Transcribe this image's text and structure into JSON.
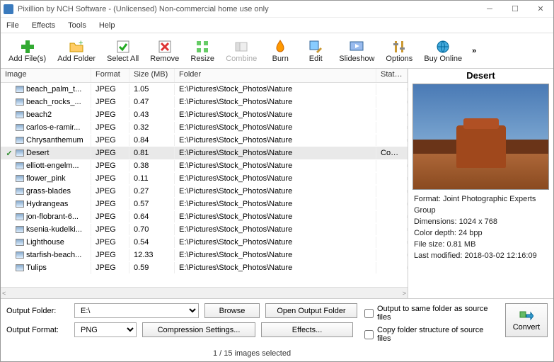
{
  "window": {
    "title": "Pixillion by NCH Software - (Unlicensed) Non-commercial home use only"
  },
  "menu": [
    "File",
    "Effects",
    "Tools",
    "Help"
  ],
  "toolbar": [
    {
      "id": "add-files",
      "label": "Add File(s)"
    },
    {
      "id": "add-folder",
      "label": "Add Folder"
    },
    {
      "id": "select-all",
      "label": "Select All"
    },
    {
      "id": "remove",
      "label": "Remove"
    },
    {
      "id": "resize",
      "label": "Resize"
    },
    {
      "id": "combine",
      "label": "Combine",
      "disabled": true
    },
    {
      "id": "burn",
      "label": "Burn"
    },
    {
      "id": "edit",
      "label": "Edit"
    },
    {
      "id": "slideshow",
      "label": "Slideshow"
    },
    {
      "id": "options",
      "label": "Options"
    },
    {
      "id": "buy-online",
      "label": "Buy Online"
    }
  ],
  "columns": {
    "image": "Image",
    "format": "Format",
    "size": "Size (MB)",
    "folder": "Folder",
    "status": "Status"
  },
  "rows": [
    {
      "name": "beach_palm_t...",
      "fmt": "JPEG",
      "size": "1.05",
      "folder": "E:\\Pictures\\Stock_Photos\\Nature",
      "status": ""
    },
    {
      "name": "beach_rocks_...",
      "fmt": "JPEG",
      "size": "0.47",
      "folder": "E:\\Pictures\\Stock_Photos\\Nature",
      "status": ""
    },
    {
      "name": "beach2",
      "fmt": "JPEG",
      "size": "0.43",
      "folder": "E:\\Pictures\\Stock_Photos\\Nature",
      "status": ""
    },
    {
      "name": "carlos-e-ramir...",
      "fmt": "JPEG",
      "size": "0.32",
      "folder": "E:\\Pictures\\Stock_Photos\\Nature",
      "status": ""
    },
    {
      "name": "Chrysanthemum",
      "fmt": "JPEG",
      "size": "0.84",
      "folder": "E:\\Pictures\\Stock_Photos\\Nature",
      "status": ""
    },
    {
      "name": "Desert",
      "fmt": "JPEG",
      "size": "0.81",
      "folder": "E:\\Pictures\\Stock_Photos\\Nature",
      "status": "Conver",
      "selected": true
    },
    {
      "name": "elliott-engelm...",
      "fmt": "JPEG",
      "size": "0.38",
      "folder": "E:\\Pictures\\Stock_Photos\\Nature",
      "status": ""
    },
    {
      "name": "flower_pink",
      "fmt": "JPEG",
      "size": "0.11",
      "folder": "E:\\Pictures\\Stock_Photos\\Nature",
      "status": ""
    },
    {
      "name": "grass-blades",
      "fmt": "JPEG",
      "size": "0.27",
      "folder": "E:\\Pictures\\Stock_Photos\\Nature",
      "status": ""
    },
    {
      "name": "Hydrangeas",
      "fmt": "JPEG",
      "size": "0.57",
      "folder": "E:\\Pictures\\Stock_Photos\\Nature",
      "status": ""
    },
    {
      "name": "jon-flobrant-6...",
      "fmt": "JPEG",
      "size": "0.64",
      "folder": "E:\\Pictures\\Stock_Photos\\Nature",
      "status": ""
    },
    {
      "name": "ksenia-kudelki...",
      "fmt": "JPEG",
      "size": "0.70",
      "folder": "E:\\Pictures\\Stock_Photos\\Nature",
      "status": ""
    },
    {
      "name": "Lighthouse",
      "fmt": "JPEG",
      "size": "0.54",
      "folder": "E:\\Pictures\\Stock_Photos\\Nature",
      "status": ""
    },
    {
      "name": "starfish-beach...",
      "fmt": "JPEG",
      "size": "12.33",
      "folder": "E:\\Pictures\\Stock_Photos\\Nature",
      "status": ""
    },
    {
      "name": "Tulips",
      "fmt": "JPEG",
      "size": "0.59",
      "folder": "E:\\Pictures\\Stock_Photos\\Nature",
      "status": ""
    }
  ],
  "preview": {
    "title": "Desert",
    "format_label": "Format:",
    "format": "Joint Photographic Experts Group",
    "dimensions_label": "Dimensions:",
    "dimensions": "1024 x 768",
    "depth_label": "Color depth:",
    "depth": "24 bpp",
    "filesize_label": "File size:",
    "filesize": "0.81 MB",
    "modified_label": "Last modified:",
    "modified": "2018-03-02 12:16:09"
  },
  "output": {
    "folder_label": "Output Folder:",
    "folder_value": "E:\\",
    "browse": "Browse",
    "open_folder": "Open Output Folder",
    "format_label": "Output Format:",
    "format_value": "PNG",
    "compression": "Compression Settings...",
    "effects": "Effects...",
    "same_folder": "Output to same folder as source files",
    "copy_structure": "Copy folder structure of source files",
    "convert": "Convert"
  },
  "status_bar": "1 / 15 images selected"
}
